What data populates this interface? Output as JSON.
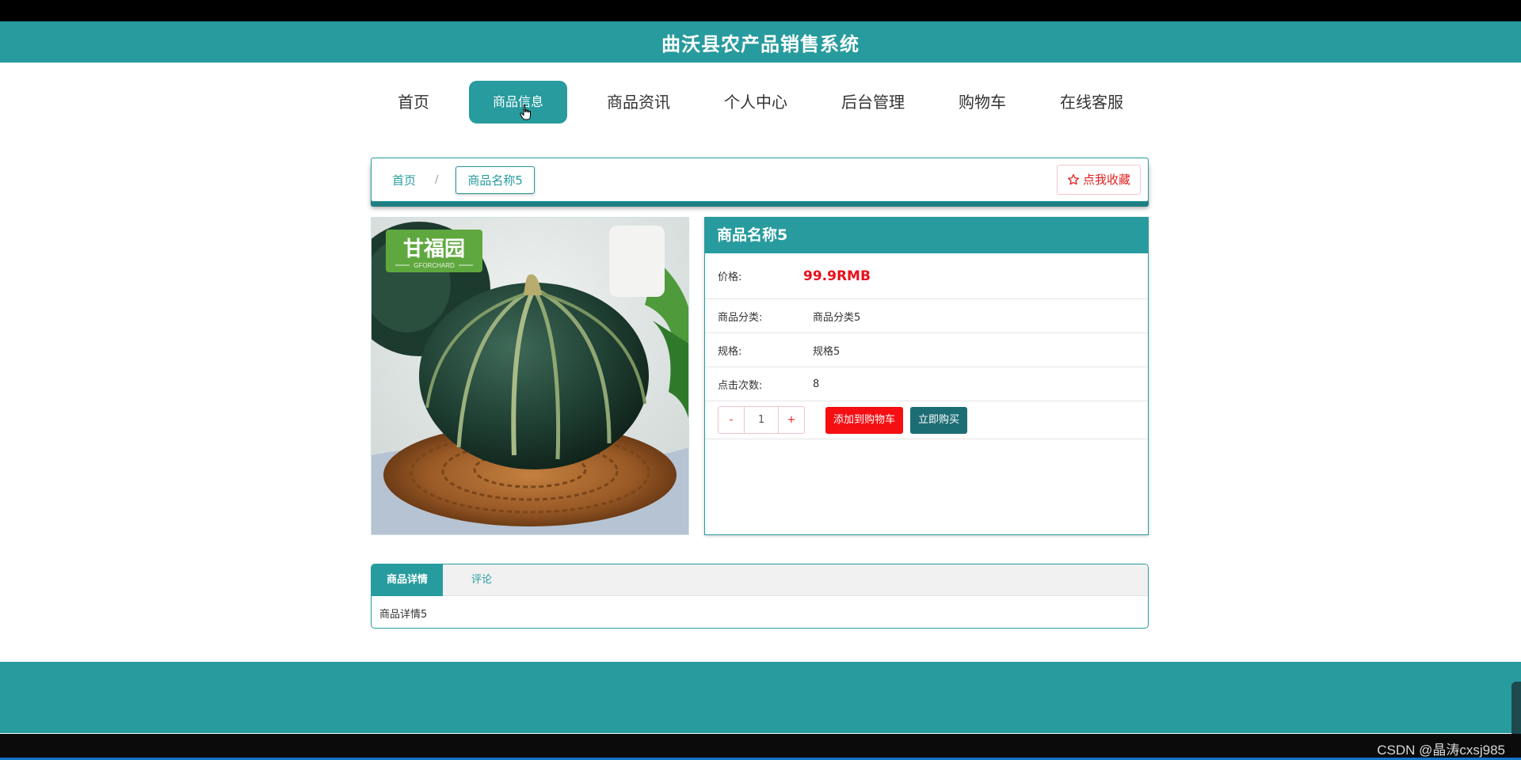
{
  "app": {
    "title": "曲沃县农产品销售系统"
  },
  "nav": {
    "items": [
      {
        "label": "首页"
      },
      {
        "label": "商品信息",
        "active": true
      },
      {
        "label": "商品资讯"
      },
      {
        "label": "个人中心"
      },
      {
        "label": "后台管理"
      },
      {
        "label": "购物车"
      },
      {
        "label": "在线客服"
      }
    ]
  },
  "breadcrumb": {
    "home": "首页",
    "separator": "/",
    "current": "商品名称5"
  },
  "favorite": {
    "label": "点我收藏",
    "icon": "star-outline-icon"
  },
  "product": {
    "name": "商品名称5",
    "image": {
      "subject": "pumpkin",
      "logo_text": "甘福园",
      "logo_subtext": "GFORCHARD"
    },
    "price_label": "价格:",
    "price": "99.9RMB",
    "category_label": "商品分类:",
    "category": "商品分类5",
    "spec_label": "规格:",
    "spec": "规格5",
    "clicks_label": "点击次数:",
    "clicks": "8",
    "quantity": "1",
    "minus": "-",
    "plus": "+",
    "add_to_cart": "添加到购物车",
    "buy_now": "立即购买"
  },
  "tabs": {
    "items": [
      {
        "label": "商品详情",
        "active": true
      },
      {
        "label": "评论"
      }
    ],
    "body": "商品详情5"
  },
  "watermark": "CSDN @晶涛cxsj985",
  "colors": {
    "brand": "#279b9e",
    "price": "#e8101b",
    "cart_button": "#f50e12",
    "buy_button": "#1d6e74"
  }
}
